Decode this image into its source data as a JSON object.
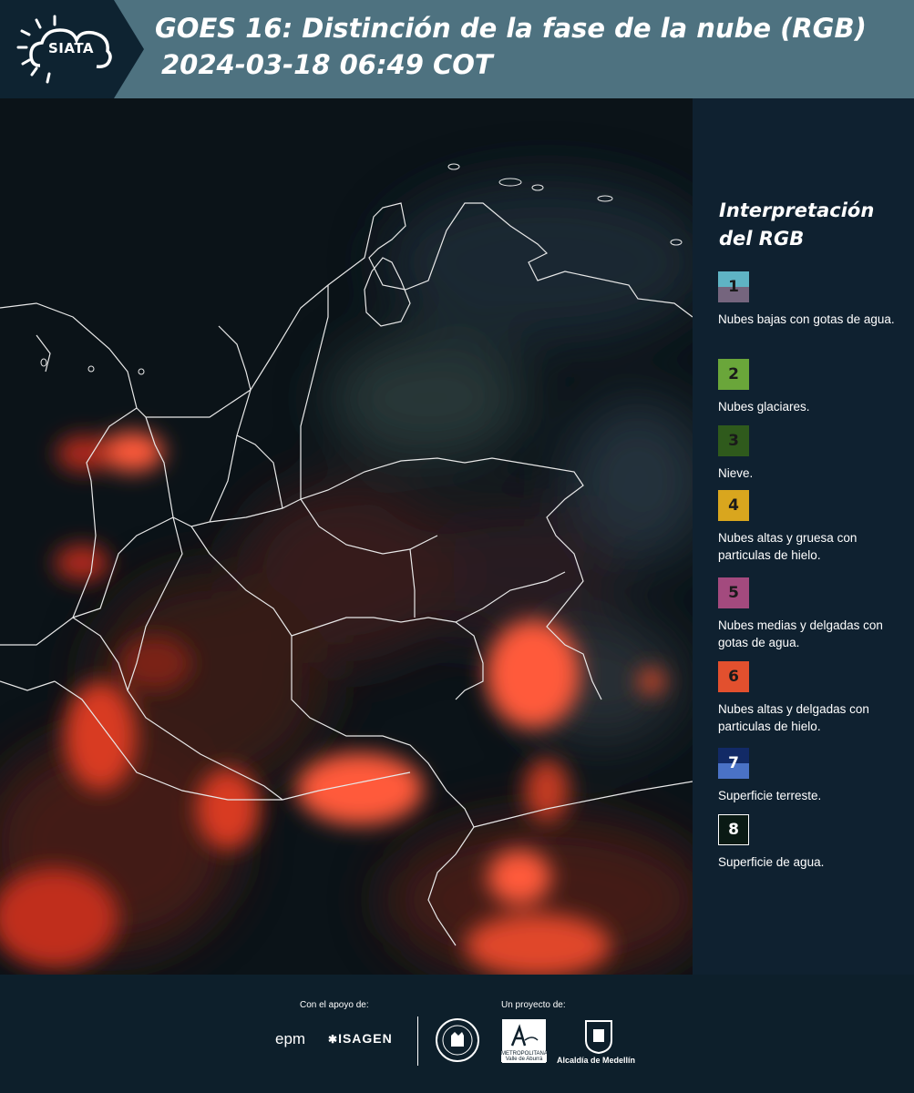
{
  "header": {
    "logo_text": "SIATA",
    "title_line1": "GOES 16: Distinción de la fase de la nube (RGB)",
    "title_line2": "2024-03-18 06:49 COT"
  },
  "legend": {
    "title": "Interpretación del RGB",
    "items": [
      {
        "number": "1",
        "label": "Nubes bajas con gotas de agua.",
        "color_top": "#5fb3c4",
        "color_bottom": "#75657e"
      },
      {
        "number": "2",
        "label": "Nubes glaciares.",
        "color": "#6aa63a"
      },
      {
        "number": "3",
        "label": "Nieve.",
        "color": "#2f5a1c"
      },
      {
        "number": "4",
        "label": "Nubes altas y gruesa con particulas de hielo.",
        "color": "#d9a61e"
      },
      {
        "number": "5",
        "label": "Nubes medias y delgadas con gotas de agua.",
        "color": "#a34a7e"
      },
      {
        "number": "6",
        "label": "Nubes altas y delgadas con particulas de hielo.",
        "color": "#e2502e"
      },
      {
        "number": "7",
        "label": "Superficie terreste.",
        "color_top": "#122a66",
        "color_bottom": "#4a72c6"
      },
      {
        "number": "8",
        "label": "Superficie de agua.",
        "color": "#0a1a14"
      }
    ]
  },
  "footer": {
    "support_label": "Con el apoyo de:",
    "project_label": "Un proyecto de:",
    "sponsors": [
      "epm",
      "ISAGEN"
    ],
    "partners": [
      "Área Metropolitana Valle de Aburrá",
      "Alcaldía de Medellín"
    ],
    "alcaldia_label": "Alcaldía de Medellín",
    "area_label_top": "METROPOLITANA",
    "area_label_bottom": "Valle de Aburrá"
  }
}
